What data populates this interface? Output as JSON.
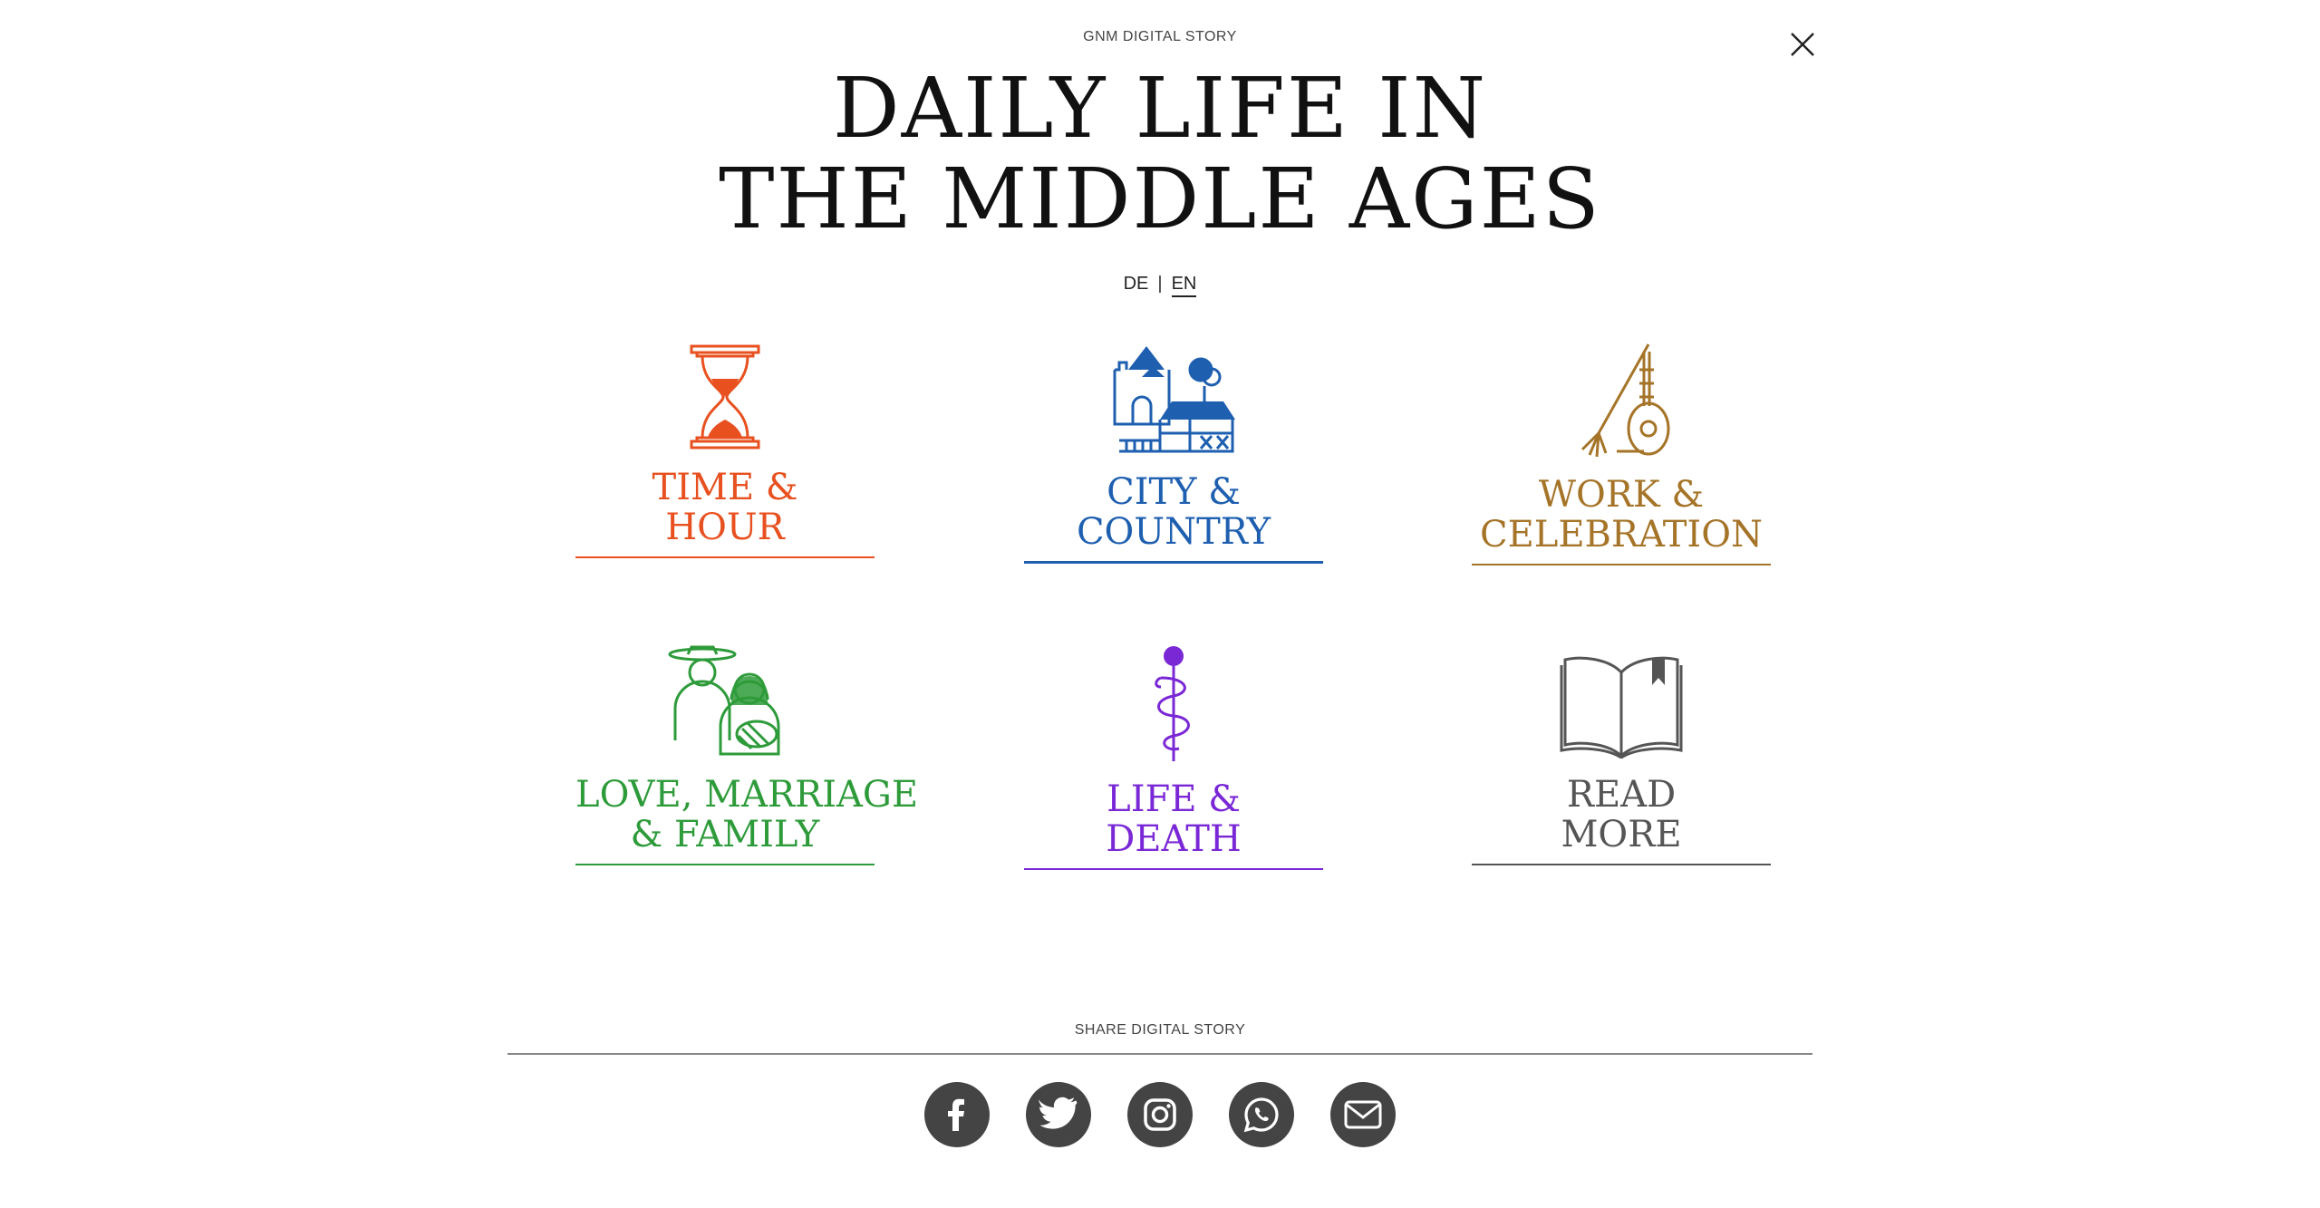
{
  "header": {
    "kicker": "GNM DIGITAL STORY",
    "title_line1": "DAILY LIFE IN",
    "title_line2": "THE MIDDLE AGES"
  },
  "language": {
    "de": "DE",
    "separator": "|",
    "en": "EN",
    "active": "EN"
  },
  "tiles": [
    {
      "line1": "TIME &",
      "line2": "HOUR",
      "color": "#e8501f",
      "icon": "hourglass-icon"
    },
    {
      "line1": "CITY &",
      "line2": "COUNTRY",
      "color": "#1e5fb0",
      "icon": "city-country-icon"
    },
    {
      "line1": "WORK &",
      "line2": "CELEBRATION",
      "color": "#a57428",
      "icon": "pitchfork-lute-icon"
    },
    {
      "line1": "LOVE, MARRIAGE",
      "line2": "& FAMILY",
      "color": "#2e9b3a",
      "icon": "family-icon"
    },
    {
      "line1": "LIFE &",
      "line2": "DEATH",
      "color": "#7a28d6",
      "icon": "staff-of-asclepius-icon"
    },
    {
      "line1": "READ",
      "line2": "MORE",
      "color": "#555555",
      "icon": "open-book-icon"
    }
  ],
  "share": {
    "label": "SHARE DIGITAL STORY",
    "icons": [
      "facebook-icon",
      "twitter-icon",
      "instagram-icon",
      "whatsapp-icon",
      "email-icon"
    ]
  }
}
